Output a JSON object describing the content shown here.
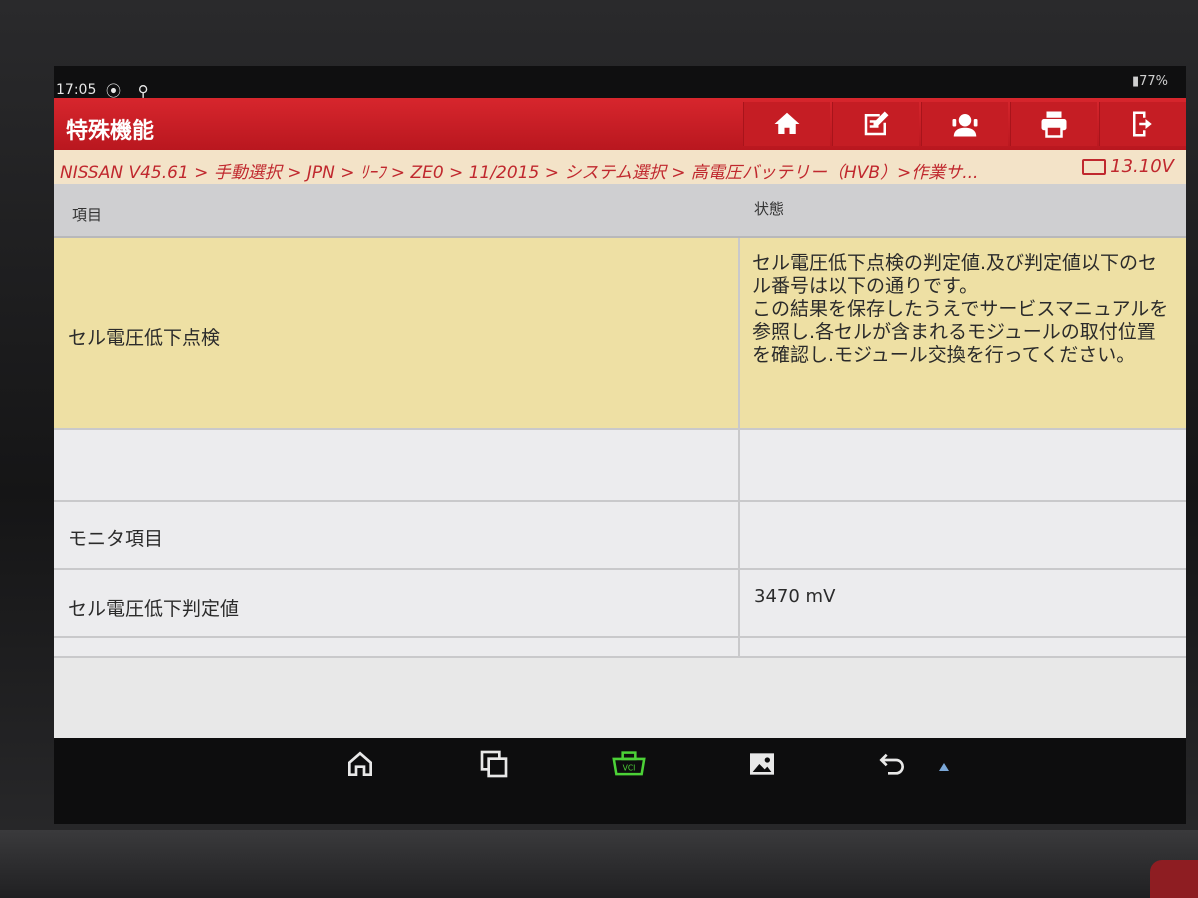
{
  "status": {
    "time": "17:05",
    "icons": "⦿ ⚲",
    "battery": "77%"
  },
  "app": {
    "title": "特殊機能",
    "toolbar": [
      {
        "name": "home-button",
        "icon": "home-icon"
      },
      {
        "name": "edit-button",
        "icon": "edit-icon"
      },
      {
        "name": "support-button",
        "icon": "support-icon"
      },
      {
        "name": "print-button",
        "icon": "print-icon"
      },
      {
        "name": "exit-button",
        "icon": "exit-icon"
      }
    ],
    "breadcrumb": "NISSAN V45.61 > 手動選択 > JPN > ﾘｰﾌ > ZE0 > 11/2015 > システム選択 > 高電圧バッテリー（HVB）>作業サ...",
    "voltage": "13.10V"
  },
  "table": {
    "headers": {
      "item": "項目",
      "status": "状態"
    },
    "rows": [
      {
        "item": "セル電圧低下点検",
        "status": "セル電圧低下点検の判定値.及び判定値以下のセル番号は以下の通りです。\nこの結果を保存したうえでサービスマニュアルを参照し.各セルが含まれるモジュールの取付位置を確認し.モジュール交換を行ってください。"
      },
      {
        "item": "",
        "status": ""
      },
      {
        "item": "モニタ項目",
        "status": ""
      },
      {
        "item": "セル電圧低下判定値",
        "status": "3470 mV"
      }
    ]
  },
  "navbar": {
    "buttons": [
      "home-icon",
      "recent-apps-icon",
      "vci-icon",
      "screenshot-icon",
      "back-icon"
    ],
    "vci_label": "VCI"
  }
}
